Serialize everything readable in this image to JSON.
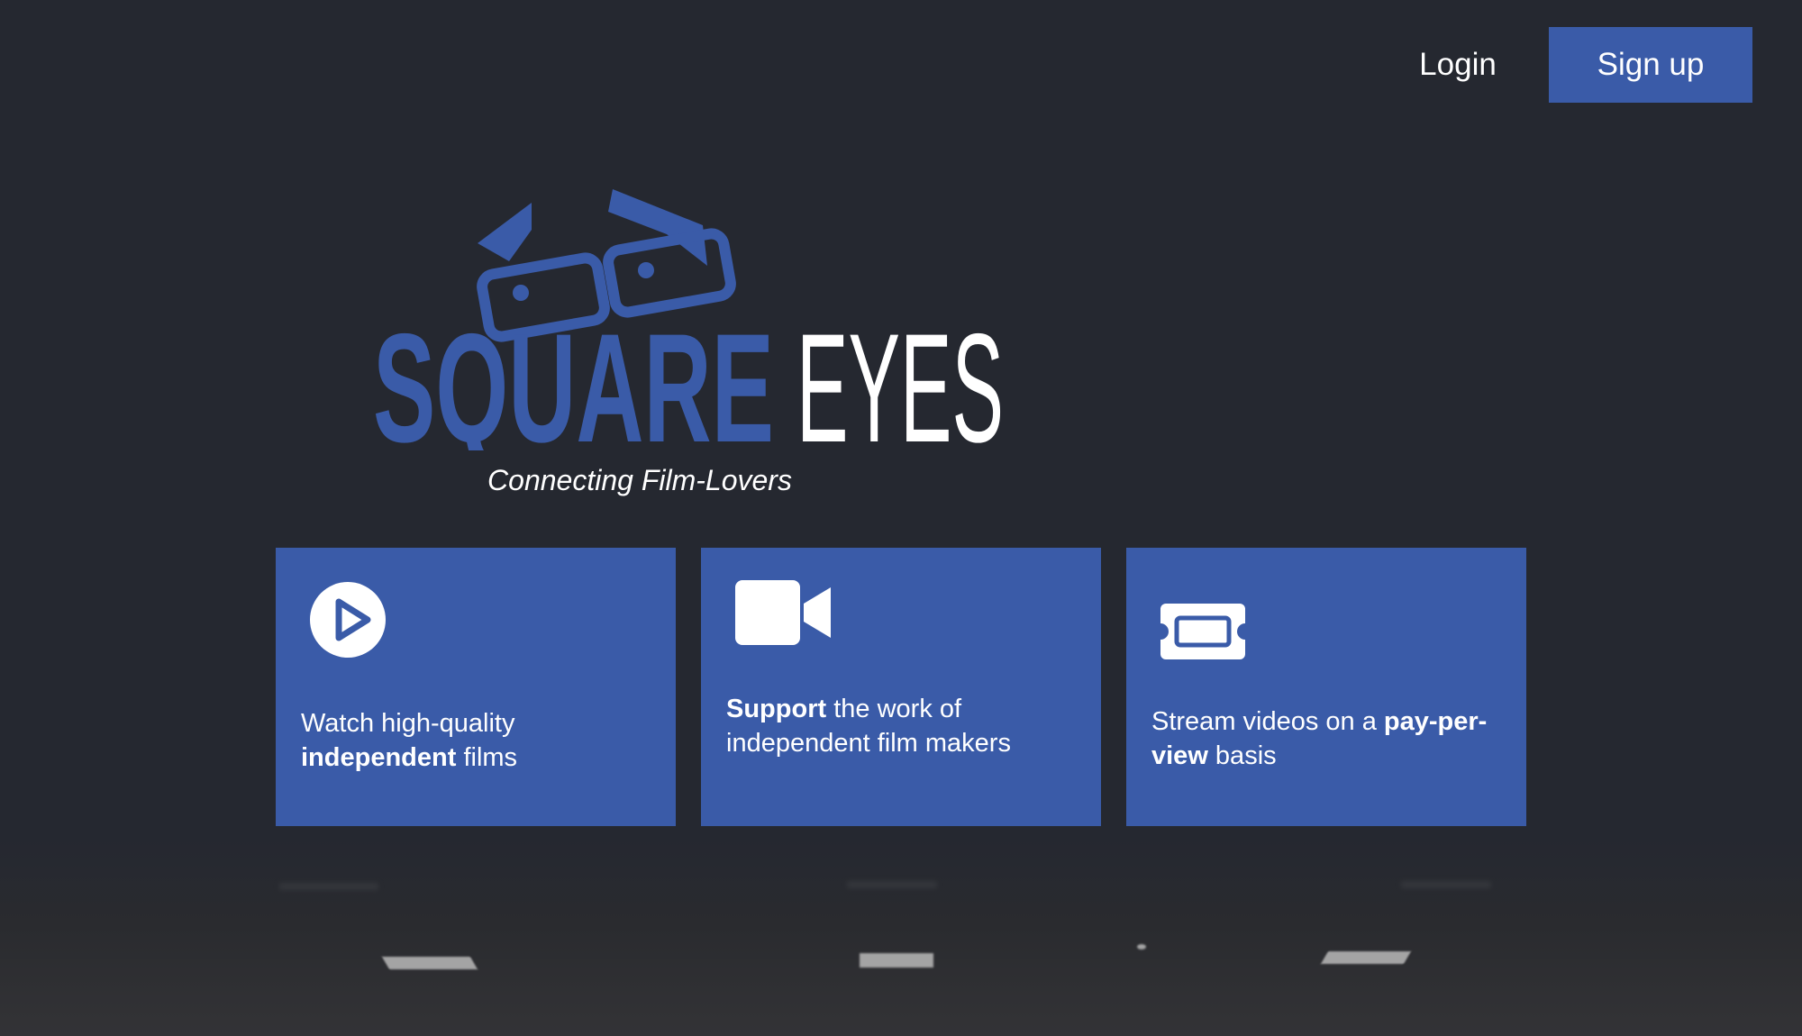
{
  "header": {
    "login_label": "Login",
    "signup_label": "Sign up"
  },
  "brand": {
    "name_part1": "SQUARE",
    "name_part2": "EYES",
    "tagline": "Connecting Film-Lovers",
    "accent_color": "#3a5ba8"
  },
  "features": [
    {
      "icon": "play-circle-icon",
      "pre": "Watch high-quality ",
      "bold": "independent",
      "post": " films"
    },
    {
      "icon": "video-camera-icon",
      "pre": "",
      "bold": "Support",
      "post": " the work of independent film makers"
    },
    {
      "icon": "ticket-icon",
      "pre": "Stream videos on a ",
      "bold": "pay-per-view",
      "post": " basis"
    }
  ]
}
